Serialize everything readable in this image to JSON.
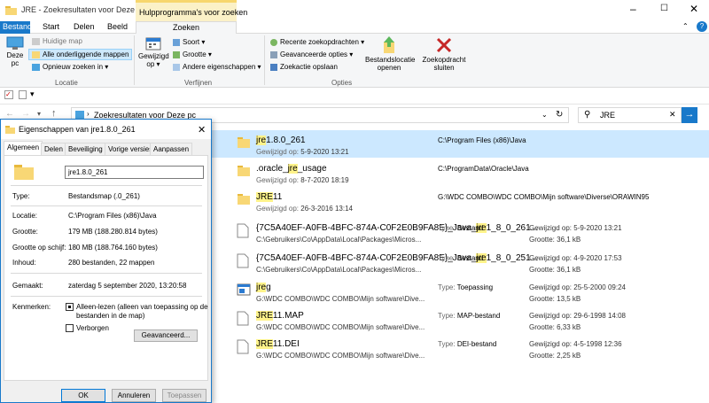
{
  "window": {
    "title": "JRE - Zoekresultaten voor Deze pc",
    "context_tab": "Hulpprogramma's voor zoeken"
  },
  "tabs": {
    "file": "Bestand",
    "start": "Start",
    "share": "Delen",
    "view": "Beeld",
    "search": "Zoeken"
  },
  "ribbon": {
    "this_pc": [
      "Deze",
      "pc"
    ],
    "current_folder": "Huidige map",
    "all_subfolders": "Alle onderliggende mappen",
    "search_again": "Opnieuw zoeken in",
    "location_group": "Locatie",
    "date_modified": [
      "Gewijzigd",
      "op"
    ],
    "kind": "Soort",
    "size": "Grootte",
    "other_props": "Andere eigenschappen",
    "refine_group": "Verfijnen",
    "recent_searches": "Recente zoekopdrachten",
    "advanced_options": "Geavanceerde opties",
    "save_search": "Zoekactie opslaan",
    "open_location": [
      "Bestandslocatie",
      "openen"
    ],
    "close_search": [
      "Zoekopdracht",
      "sluiten"
    ],
    "options_group": "Opties"
  },
  "address": {
    "path": "Zoekresultaten voor Deze pc",
    "search_value": "JRE"
  },
  "results": [
    {
      "name_pre": "",
      "name_hl": "jre",
      "name_post": "1.8.0_261",
      "sub_k": "Gewijzigd op:",
      "sub_v": "5-9-2020 13:21",
      "c2": "C:\\Program Files (x86)\\Java",
      "type": "folder",
      "selected": true
    },
    {
      "name_pre": ".oracle_",
      "name_hl": "jre",
      "name_post": "_usage",
      "sub_k": "Gewijzigd op:",
      "sub_v": "8-7-2020 18:19",
      "c2": "C:\\ProgramData\\Oracle\\Java",
      "type": "folder"
    },
    {
      "name_pre": "",
      "name_hl": "JRE",
      "name_post": "11",
      "sub_k": "Gewijzigd op:",
      "sub_v": "26-3-2016 13:14",
      "c2": "G:\\WDC COMBO\\WDC COMBO\\Mijn software\\Diverse\\ORAWIN95",
      "type": "folder"
    },
    {
      "name_pre": "{7C5A40EF-A0FB-4BFC-874A-C0F2E0B9FA8E}_Java_",
      "name_hl": "jre",
      "name_post": "1_8_0_261...",
      "sub_k": "",
      "sub_v": "C:\\Gebruikers\\Co\\AppData\\Local\\Packages\\Micros...",
      "c2k": "Type:",
      "c2": "Bestand",
      "c3a": "Gewijzigd op: 5-9-2020 13:21",
      "c3b": "Grootte: 36,1 kB",
      "type": "file"
    },
    {
      "name_pre": "{7C5A40EF-A0FB-4BFC-874A-C0F2E0B9FA8E}_Java_",
      "name_hl": "jre",
      "name_post": "1_8_0_251...",
      "sub_k": "",
      "sub_v": "C:\\Gebruikers\\Co\\AppData\\Local\\Packages\\Micros...",
      "c2k": "Type:",
      "c2": "Bestand",
      "c3a": "Gewijzigd op: 4-9-2020 17:53",
      "c3b": "Grootte: 36,1 kB",
      "type": "file"
    },
    {
      "name_pre": "",
      "name_hl": "jre",
      "name_post": "g",
      "sub_k": "",
      "sub_v": "G:\\WDC COMBO\\WDC COMBO\\Mijn software\\Dive...",
      "c2k": "Type:",
      "c2": "Toepassing",
      "c3a": "Gewijzigd op: 25-5-2000 09:24",
      "c3b": "Grootte: 13,5 kB",
      "type": "app"
    },
    {
      "name_pre": "",
      "name_hl": "JRE",
      "name_post": "11.MAP",
      "sub_k": "",
      "sub_v": "G:\\WDC COMBO\\WDC COMBO\\Mijn software\\Dive...",
      "c2k": "Type:",
      "c2": "MAP-bestand",
      "c3a": "Gewijzigd op: 29-6-1998 14:08",
      "c3b": "Grootte: 6,33 kB",
      "type": "file"
    },
    {
      "name_pre": "",
      "name_hl": "JRE",
      "name_post": "11.DEI",
      "sub_k": "",
      "sub_v": "G:\\WDC COMBO\\WDC COMBO\\Mijn software\\Dive...",
      "c2k": "Type:",
      "c2": "DEI-bestand",
      "c3a": "Gewijzigd op: 4-5-1998 12:36",
      "c3b": "Grootte: 2,25 kB",
      "type": "file"
    }
  ],
  "dialog": {
    "title": "Eigenschappen van jre1.8.0_261",
    "tabs": [
      "Algemeen",
      "Delen",
      "Beveiliging",
      "Vorige versies",
      "Aanpassen"
    ],
    "name_value": "jre1.8.0_261",
    "props": [
      {
        "label": "Type:",
        "value": "Bestandsmap (.0_261)"
      },
      {
        "label": "Locatie:",
        "value": "C:\\Program Files (x86)\\Java"
      },
      {
        "label": "Grootte:",
        "value": "179 MB (188.280.814 bytes)"
      },
      {
        "label": "Grootte op schijf:",
        "value": "180 MB (188.764.160 bytes)"
      },
      {
        "label": "Inhoud:",
        "value": "280 bestanden, 22 mappen"
      },
      {
        "label": "Gemaakt:",
        "value": "zaterdag 5 september 2020, 13:20:58"
      }
    ],
    "attributes_label": "Kenmerken:",
    "readonly_label": "Alleen-lezen (alleen van toepassing op de",
    "readonly_label2": "bestanden in de map)",
    "hidden_label": "Verborgen",
    "advanced_button": "Geavanceerd...",
    "ok": "OK",
    "cancel": "Annuleren",
    "apply": "Toepassen"
  }
}
